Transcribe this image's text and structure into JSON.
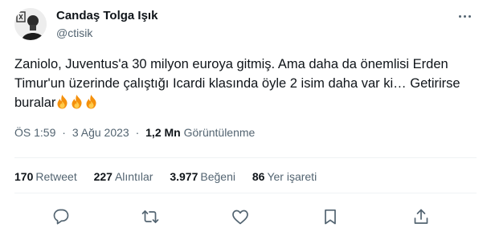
{
  "author": {
    "name": "Candaş Tolga Işık",
    "handle": "@ctisik",
    "avatar_icon": "profile-photo"
  },
  "tweet": {
    "line1": "Zaniolo, Juventus'a 30 milyon euroya gitmiş. Ama daha da önemlisi Erden",
    "line2": "Timur'un üzerinde çalıştığı Icardi klasında öyle 2 isim daha var ki… Getirirse",
    "line3": "buralar",
    "emoji": [
      "fire",
      "fire",
      "fire"
    ]
  },
  "meta": {
    "time": "ÖS 1:59",
    "separator": "·",
    "date": "3 Ağu 2023",
    "views_count": "1,2 Mn",
    "views_label": "Görüntülenme"
  },
  "stats": {
    "retweets": {
      "count": "170",
      "label": "Retweet"
    },
    "quotes": {
      "count": "227",
      "label": "Alıntılar"
    },
    "likes": {
      "count": "3.977",
      "label": "Beğeni"
    },
    "bookmarks": {
      "count": "86",
      "label": "Yer işareti"
    }
  },
  "actions": [
    "reply-icon",
    "retweet-icon",
    "like-icon",
    "bookmark-icon",
    "share-icon"
  ],
  "colors": {
    "text": "#0f1419",
    "secondary": "#536471",
    "divider": "#eff3f4",
    "background": "#ffffff"
  }
}
